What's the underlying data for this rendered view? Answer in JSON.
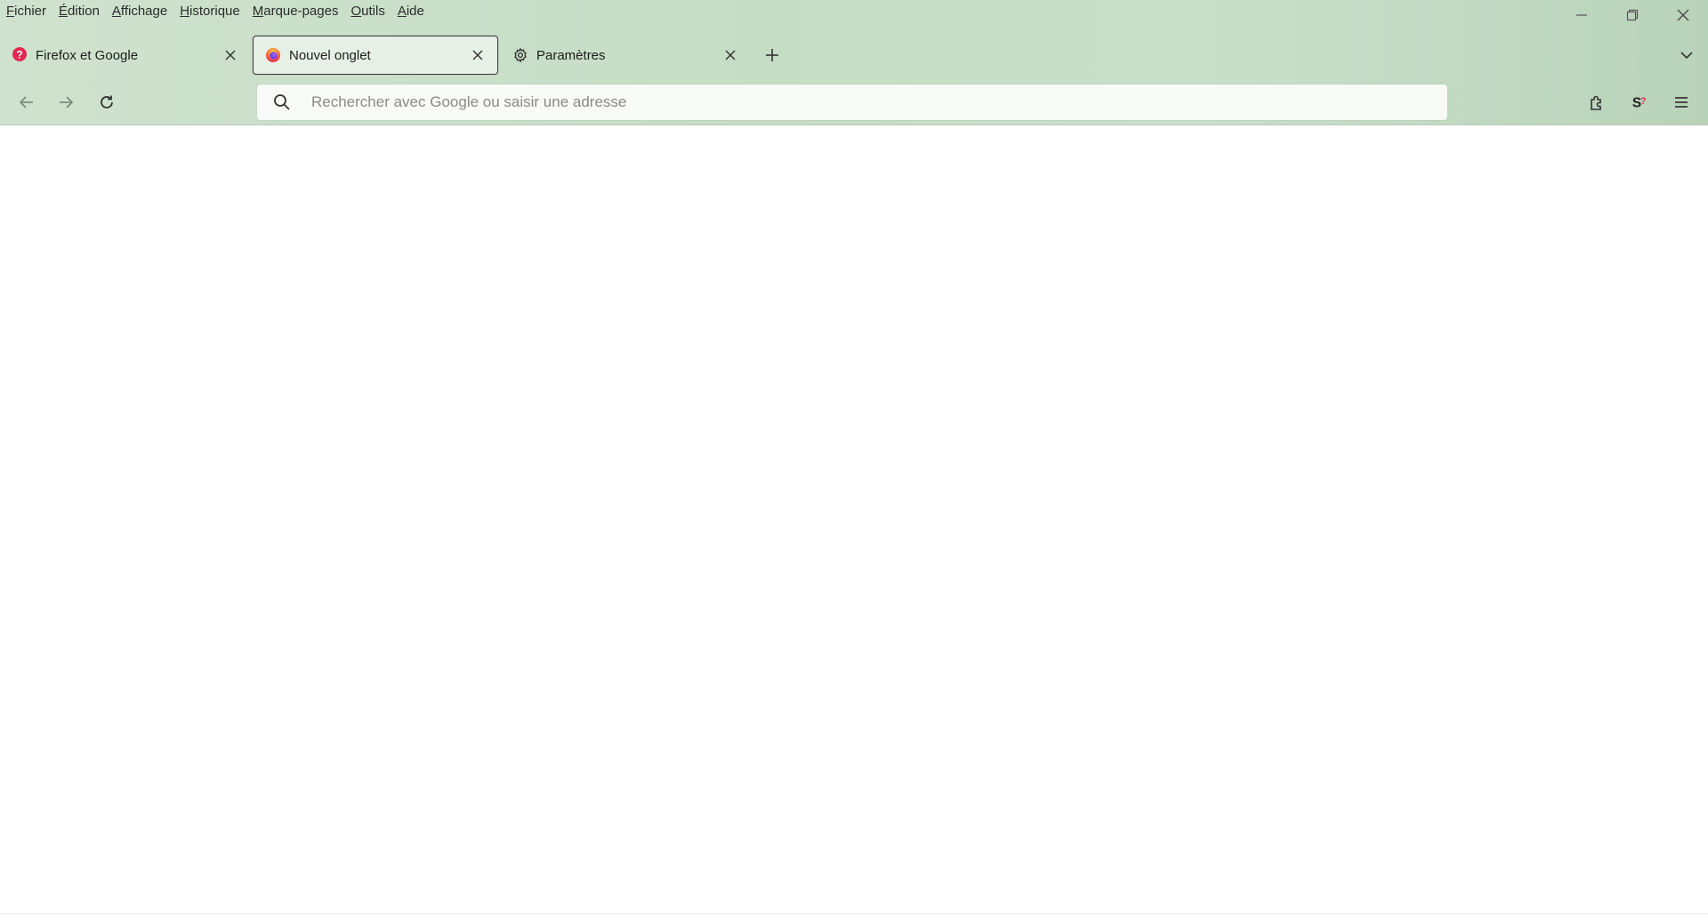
{
  "menubar": {
    "items": [
      {
        "label": "Fichier"
      },
      {
        "label": "Édition"
      },
      {
        "label": "Affichage"
      },
      {
        "label": "Historique"
      },
      {
        "label": "Marque-pages"
      },
      {
        "label": "Outils"
      },
      {
        "label": "Aide"
      }
    ]
  },
  "tabs": [
    {
      "title": "Firefox et Google",
      "icon": "help-icon",
      "active": false
    },
    {
      "title": "Nouvel onglet",
      "icon": "firefox-icon",
      "active": true
    },
    {
      "title": "Paramètres",
      "icon": "gear-icon",
      "active": false
    }
  ],
  "urlbar": {
    "placeholder": "Rechercher avec Google ou saisir une adresse",
    "value": ""
  },
  "colors": {
    "chrome_bg": "#c5ddc5",
    "active_tab_bg": "#e6f0e6",
    "help_red": "#e22850",
    "content_bg": "#ffffff"
  }
}
